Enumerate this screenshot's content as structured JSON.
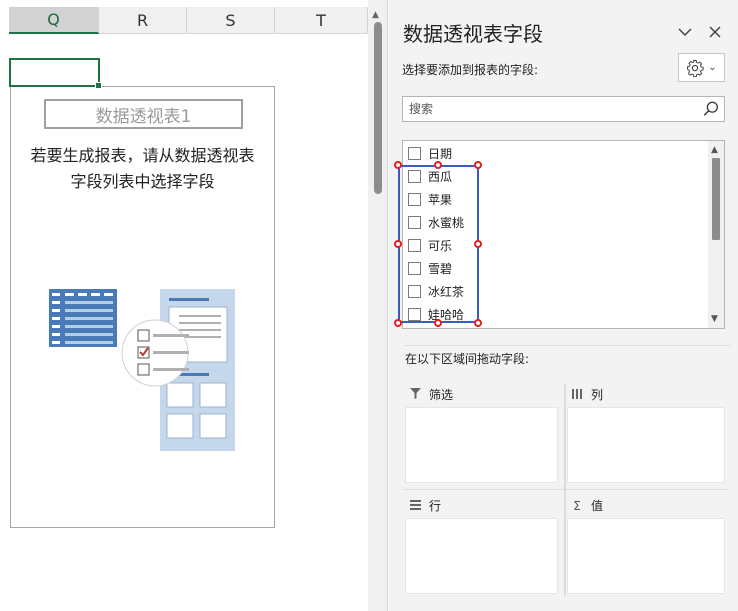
{
  "sheet": {
    "columns": [
      "Q",
      "R",
      "S",
      "T"
    ],
    "active_column": "Q",
    "pivot_table_name": "数据透视表1",
    "pivot_hint_line1": "若要生成报表，请从数据透视表",
    "pivot_hint_line2": "字段列表中选择字段"
  },
  "pane": {
    "title": "数据透视表字段",
    "subtitle": "选择要添加到报表的字段:",
    "search_placeholder": "搜索",
    "fields": [
      "日期",
      "西瓜",
      "苹果",
      "水蜜桃",
      "可乐",
      "雪碧",
      "冰红茶",
      "娃哈哈"
    ],
    "drag_label": "在以下区域间拖动字段:",
    "areas": {
      "filter": "筛选",
      "columns": "列",
      "rows": "行",
      "values": "值"
    },
    "icons": {
      "chevron": "chevron-down-icon",
      "close": "close-icon",
      "settings": "gear-icon",
      "search": "search-icon",
      "filter": "funnel-icon",
      "columns": "columns-icon",
      "rows": "rows-icon",
      "values": "sigma-icon"
    }
  },
  "colors": {
    "excel_green": "#1e7145",
    "selection_blue": "#3b5bbf",
    "handle_red": "#e02020",
    "illustration_blue": "#4a7ab8"
  }
}
